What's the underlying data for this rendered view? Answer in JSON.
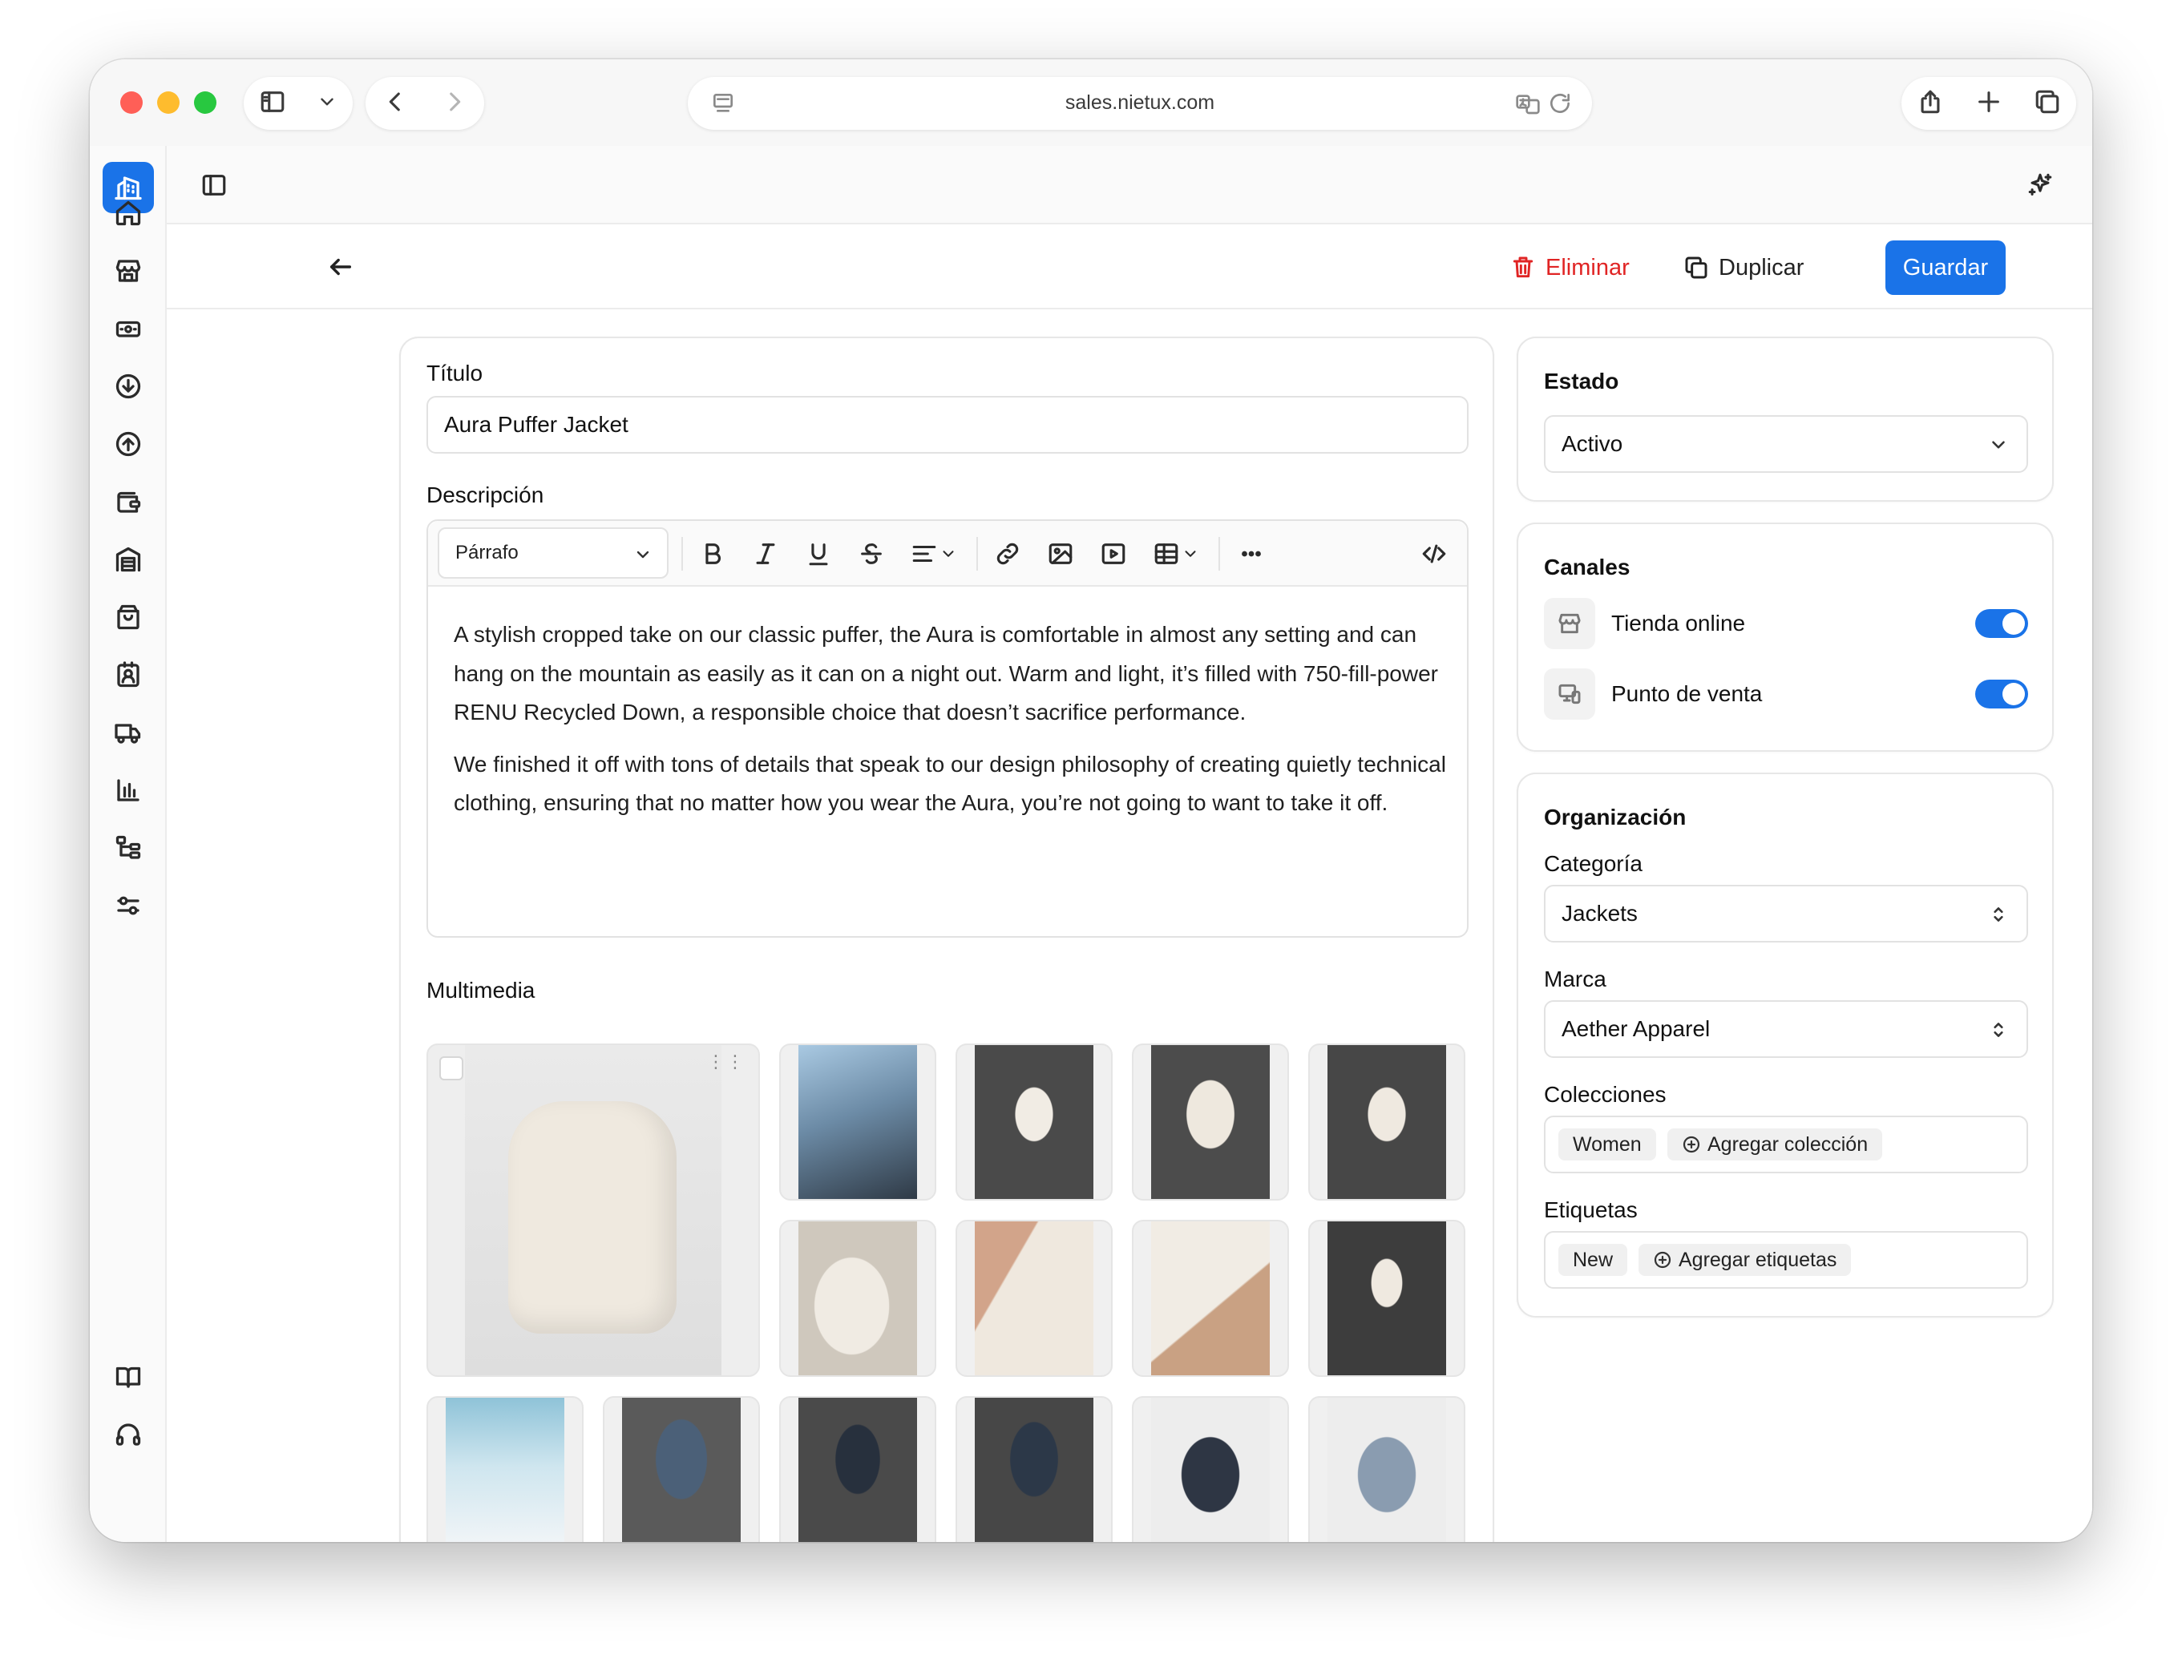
{
  "browser": {
    "url": "sales.nietux.com"
  },
  "header": {
    "delete_label": "Eliminar",
    "duplicate_label": "Duplicar",
    "save_label": "Guardar"
  },
  "product": {
    "title_label": "Título",
    "title_value": "Aura Puffer Jacket",
    "description_label": "Descripción",
    "format_value": "Párrafo",
    "description_paragraphs": [
      "A stylish cropped take on our classic puffer, the Aura is comfortable in almost any setting and can hang on the mountain as easily as it can on a night out. Warm and light, it’s filled with 750-fill-power RENU Recycled Down, a responsible choice that doesn’t sacrifice performance.",
      "We finished it off with tons of details that speak to our design philosophy of creating quietly technical clothing, ensuring that no matter how you wear the Aura, you’re not going to want to take it off."
    ],
    "media_label": "Multimedia"
  },
  "status": {
    "label": "Estado",
    "value": "Activo"
  },
  "channels": {
    "label": "Canales",
    "items": [
      {
        "label": "Tienda online",
        "enabled": true,
        "icon": "store-icon"
      },
      {
        "label": "Punto de venta",
        "enabled": true,
        "icon": "pos-devices-icon"
      }
    ]
  },
  "organization": {
    "label": "Organización",
    "category_label": "Categoría",
    "category_value": "Jackets",
    "brand_label": "Marca",
    "brand_value": "Aether Apparel",
    "collections_label": "Colecciones",
    "collections": [
      "Women"
    ],
    "add_collection_label": "Agregar colección",
    "tags_label": "Etiquetas",
    "tags": [
      "New"
    ],
    "add_tags_label": "Agregar etiquetas"
  },
  "colors": {
    "accent": "#1a73e8",
    "danger": "#e02424"
  }
}
